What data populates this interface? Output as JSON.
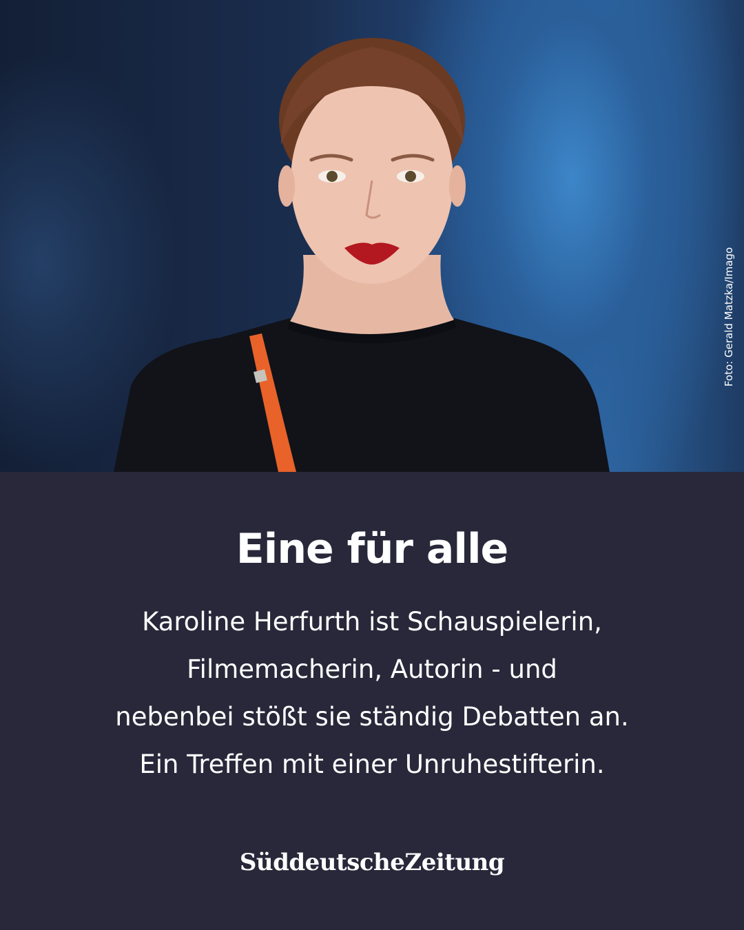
{
  "photo": {
    "credit": "Foto: Gerald Matzka/Imago"
  },
  "article": {
    "headline": "Eine für alle",
    "teaser_lines": [
      "Karoline Herfurth ist Schauspielerin,",
      "Filmemacherin, Autorin - und",
      "nebenbei stößt sie ständig Debatten an.",
      "Ein Treffen mit einer Unruhestifterin."
    ]
  },
  "brand": {
    "logo_text": "SüddeutscheZeitung"
  },
  "colors": {
    "panel_background": "#28283a",
    "text": "#ffffff",
    "backdrop_blue": "#2f6aa8",
    "strap_orange": "#e8622a"
  }
}
